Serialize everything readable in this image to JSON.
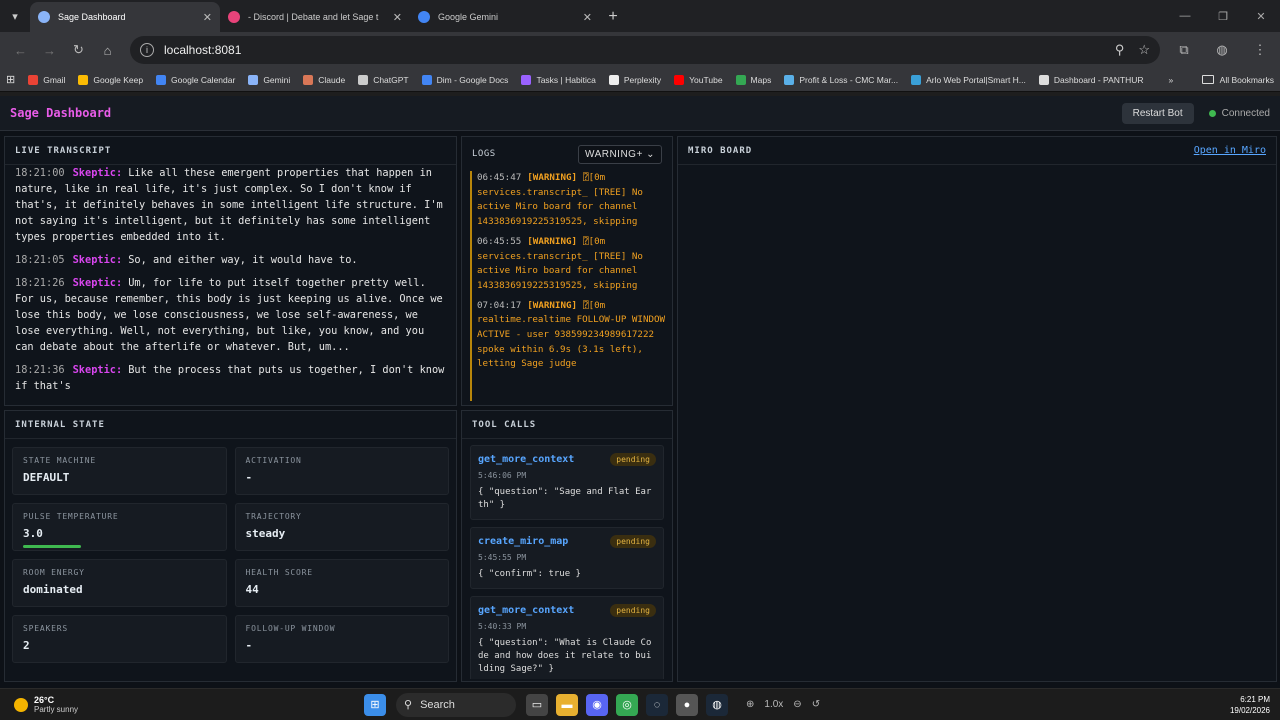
{
  "browser": {
    "tabs": [
      {
        "title": "Sage Dashboard",
        "active": true,
        "color": "#8ab4f8"
      },
      {
        "title": "- Discord | Debate and let Sage t",
        "active": false,
        "color": "#e8437a"
      },
      {
        "title": "Google Gemini",
        "active": false,
        "color": "#4285f4"
      }
    ],
    "url": "localhost:8081",
    "bookmarks": [
      {
        "label": "Gmail",
        "color": "#ea4335"
      },
      {
        "label": "Google Keep",
        "color": "#fbbc04"
      },
      {
        "label": "Google Calendar",
        "color": "#4285f4"
      },
      {
        "label": "Gemini",
        "color": "#8ab4f8"
      },
      {
        "label": "Claude",
        "color": "#d97757"
      },
      {
        "label": "ChatGPT",
        "color": "#cccccc"
      },
      {
        "label": "Dim - Google Docs",
        "color": "#4285f4"
      },
      {
        "label": "Tasks | Habitica",
        "color": "#9a62ff"
      },
      {
        "label": "Perplexity",
        "color": "#eeeeee"
      },
      {
        "label": "YouTube",
        "color": "#ff0000"
      },
      {
        "label": "Maps",
        "color": "#34a853"
      },
      {
        "label": "Profit & Loss - CMC Mar...",
        "color": "#5ab0e8"
      },
      {
        "label": "Arlo Web Portal|Smart H...",
        "color": "#3aa0d8"
      },
      {
        "label": "Dashboard - PANTHUR",
        "color": "#dddddd"
      }
    ],
    "bookmarks_more": "»",
    "all_bookmarks": "All Bookmarks"
  },
  "app": {
    "title": "Sage Dashboard",
    "restart_label": "Restart Bot",
    "connection_status": "Connected"
  },
  "transcript": {
    "heading": "LIVE TRANSCRIPT",
    "lines": [
      {
        "time": "18:21:00",
        "speaker": "Skeptic:",
        "text": "Like all these emergent properties that happen in nature, like in real life, it's just complex. So I don't know if that's, it definitely behaves in some intelligent life structure. I'm not saying it's intelligent, but it definitely has some intelligent types properties embedded into it."
      },
      {
        "time": "18:21:05",
        "speaker": "Skeptic:",
        "text": "So, and either way, it would have to."
      },
      {
        "time": "18:21:26",
        "speaker": "Skeptic:",
        "text": "Um, for life to put itself together pretty well. For us, because remember, this body is just keeping us alive. Once we lose this body, we lose consciousness, we lose self-awareness, we lose everything. Well, not everything, but like, you know, and you can debate about the afterlife or whatever. But, um..."
      },
      {
        "time": "18:21:36",
        "speaker": "Skeptic:",
        "text": "But the process that puts us together, I don't know if that's"
      }
    ]
  },
  "logs": {
    "heading": "LOGS",
    "filter": "WARNING+",
    "entries": [
      {
        "time": "06:45:47",
        "level": "[WARNING]",
        "text": "⍰[0m services.transcript_ [TREE] No active Miro board for channel 1433836919225319525, skipping"
      },
      {
        "time": "06:45:55",
        "level": "[WARNING]",
        "text": "⍰[0m services.transcript_ [TREE] No active Miro board for channel 1433836919225319525, skipping"
      },
      {
        "time": "07:04:17",
        "level": "[WARNING]",
        "text": "⍰[0m realtime.realtime FOLLOW-UP WINDOW ACTIVE - user 938599234989617222 spoke within 6.9s (3.1s left), letting Sage judge"
      }
    ]
  },
  "miro": {
    "heading": "MIRO BOARD",
    "open_link": "Open in Miro"
  },
  "state": {
    "heading": "INTERNAL STATE",
    "cards": [
      {
        "label": "STATE MACHINE",
        "value": "DEFAULT"
      },
      {
        "label": "ACTIVATION",
        "value": "-"
      },
      {
        "label": "PULSE TEMPERATURE",
        "value": "3.0",
        "bar": true
      },
      {
        "label": "TRAJECTORY",
        "value": "steady"
      },
      {
        "label": "ROOM ENERGY",
        "value": "dominated"
      },
      {
        "label": "HEALTH SCORE",
        "value": "44"
      },
      {
        "label": "SPEAKERS",
        "value": "2"
      },
      {
        "label": "FOLLOW-UP WINDOW",
        "value": "-"
      }
    ]
  },
  "tools": {
    "heading": "TOOL CALLS",
    "calls": [
      {
        "name": "get_more_context",
        "status": "pending",
        "time": "5:46:06 PM",
        "args": "{ \"question\": \"Sage and Flat Earth\" }"
      },
      {
        "name": "create_miro_map",
        "status": "pending",
        "time": "5:45:55 PM",
        "args": "{ \"confirm\": true }"
      },
      {
        "name": "get_more_context",
        "status": "pending",
        "time": "5:40:33 PM",
        "args": "{ \"question\": \"What is Claude Code and how does it relate to building Sage?\" }"
      }
    ]
  },
  "taskbar": {
    "temperature": "26°C",
    "weather": "Partly sunny",
    "search": "Search",
    "zoom": "1.0x",
    "time": "6:21 PM",
    "date": "19/02/2026"
  },
  "colors": {
    "accent_pink": "#e85ce8",
    "link_blue": "#58a6ff",
    "warning_orange": "#f0a020",
    "connected_green": "#3fb950"
  }
}
